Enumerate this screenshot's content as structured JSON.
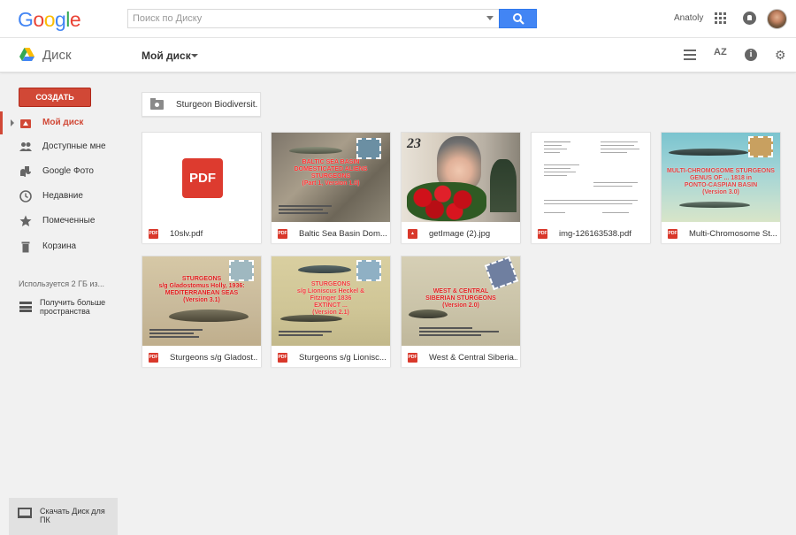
{
  "header": {
    "logo_letters": [
      {
        "ch": "G",
        "color": "#4285f4"
      },
      {
        "ch": "o",
        "color": "#ea4335"
      },
      {
        "ch": "o",
        "color": "#fbbc05"
      },
      {
        "ch": "g",
        "color": "#4285f4"
      },
      {
        "ch": "l",
        "color": "#34a853"
      },
      {
        "ch": "e",
        "color": "#ea4335"
      }
    ],
    "search_placeholder": "Поиск по Диску",
    "user_name": "Anatoly"
  },
  "subbar": {
    "app_title": "Диск",
    "breadcrumb": "Мой диск",
    "sort_label": "AZ"
  },
  "sidebar": {
    "create_label": "СОЗДАТЬ",
    "items": [
      {
        "label": "Мой диск",
        "icon": "my-drive-icon",
        "active": true
      },
      {
        "label": "Доступные мне",
        "icon": "shared-people-icon"
      },
      {
        "label": "Google Фото",
        "icon": "photos-pinwheel-icon"
      },
      {
        "label": "Недавние",
        "icon": "clock-icon"
      },
      {
        "label": "Помеченные",
        "icon": "star-icon"
      },
      {
        "label": "Корзина",
        "icon": "trash-icon"
      }
    ],
    "storage_text": "Используется 2 ГБ из...",
    "get_more_label": "Получить больше пространства",
    "download_label": "Скачать Диск для ПК"
  },
  "main": {
    "folder": {
      "name": "Sturgeon Biodiversit..."
    },
    "files": [
      {
        "name": "10slv.pdf",
        "type": "pdf"
      },
      {
        "name": "Baltic Sea Basin Dom...",
        "type": "pdf",
        "slide_title": "BALTIC SEA BASIN DOMESTICATED ALIENS STURGEONS (Part 1, Version 1.0)"
      },
      {
        "name": "getImage (2).jpg",
        "type": "image",
        "overlay_text": "23"
      },
      {
        "name": "img-126163538.pdf",
        "type": "pdf"
      },
      {
        "name": "Multi-Chromosome St...",
        "type": "pdf",
        "slide_title": "MULTI-CHROMOSOME STURGEONS GENUS OF ... 1818 in PONTO-CASPIAN BASIN (Version 3.0)"
      },
      {
        "name": "Sturgeons s/g Gladost...",
        "type": "pdf",
        "slide_title": "STURGEONS s/g Gladostomus Holly, 1936: MEDITERRANEAN SEAS (Version 3.1)"
      },
      {
        "name": "Sturgeons s/g Lionisc...",
        "type": "pdf",
        "slide_title": "STURGEONS s/g Lioniscus Heckel & Fitzinger 1836 EXTINCT ... (Version 2.1)"
      },
      {
        "name": "West & Central Siberia...",
        "type": "pdf",
        "slide_title": "WEST & CENTRAL SIBERIAN STURGEONS (Version 2.0)"
      }
    ]
  },
  "colors": {
    "accent_red": "#d14836",
    "search_blue": "#4285f4"
  }
}
